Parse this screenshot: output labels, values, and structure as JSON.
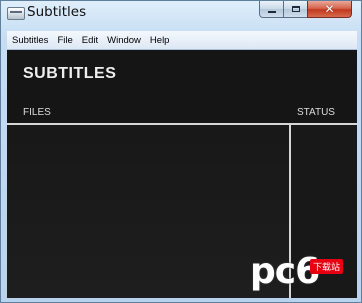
{
  "window": {
    "title": "Subtitles",
    "controls": {
      "minimize": "minimize",
      "maximize": "maximize",
      "close": "✕"
    }
  },
  "menubar": {
    "items": [
      "Subtitles",
      "File",
      "Edit",
      "Window",
      "Help"
    ]
  },
  "main": {
    "header": "SUBTITLES",
    "columns": {
      "files": "FILES",
      "status": "STATUS"
    }
  },
  "watermark": {
    "logo_text": "pc6",
    "badge": "下载站"
  },
  "colors": {
    "client_bg": "#151515",
    "text": "#dddddd",
    "divider": "#d6d6d6"
  }
}
